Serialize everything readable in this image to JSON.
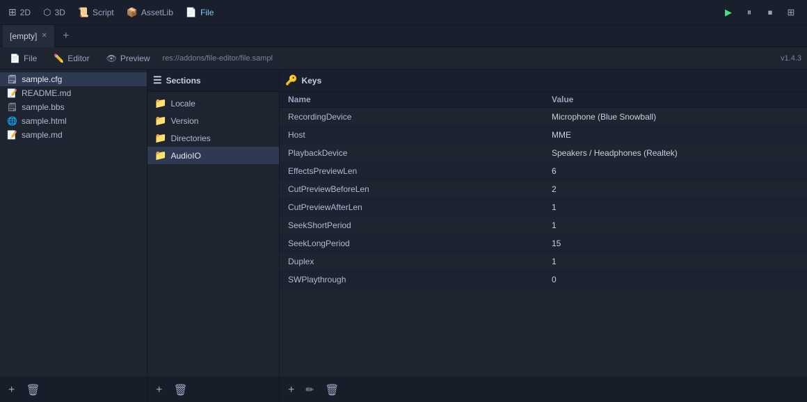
{
  "topbar": {
    "buttons": [
      {
        "id": "2d",
        "label": "2D",
        "icon": "2d-icon",
        "active": false
      },
      {
        "id": "3d",
        "label": "3D",
        "icon": "3d-icon",
        "active": false
      },
      {
        "id": "script",
        "label": "Script",
        "icon": "script-icon",
        "active": false
      },
      {
        "id": "assetlib",
        "label": "AssetLib",
        "icon": "assetlib-icon",
        "active": false
      },
      {
        "id": "file",
        "label": "File",
        "icon": "file-icon",
        "active": true
      }
    ],
    "controls": [
      "play",
      "pause",
      "stop",
      "layout"
    ]
  },
  "tabs": [
    {
      "id": "empty-tab",
      "label": "[empty]",
      "closable": true
    }
  ],
  "toolbar": {
    "file_btn": "File",
    "editor_btn": "Editor",
    "preview_btn": "Preview",
    "breadcrumb": "res://addons/file-editor/file.sampl",
    "version": "v1.4.3"
  },
  "sections_panel": {
    "header": "Sections",
    "items": [
      {
        "id": "locale",
        "label": "Locale",
        "icon": "folder-icon"
      },
      {
        "id": "version",
        "label": "Version",
        "icon": "folder-icon"
      },
      {
        "id": "directories",
        "label": "Directories",
        "icon": "folder-icon"
      },
      {
        "id": "audioio",
        "label": "AudioIO",
        "icon": "folder-icon",
        "active": true
      }
    ]
  },
  "keys_panel": {
    "header": "Keys",
    "col_name": "Name",
    "col_value": "Value",
    "rows": [
      {
        "name": "RecordingDevice",
        "value": "Microphone (Blue Snowball)"
      },
      {
        "name": "Host",
        "value": "MME"
      },
      {
        "name": "PlaybackDevice",
        "value": "Speakers / Headphones (Realtek)"
      },
      {
        "name": "EffectsPreviewLen",
        "value": "6"
      },
      {
        "name": "CutPreviewBeforeLen",
        "value": "2"
      },
      {
        "name": "CutPreviewAfterLen",
        "value": "1"
      },
      {
        "name": "SeekShortPeriod",
        "value": "1"
      },
      {
        "name": "SeekLongPeriod",
        "value": "15"
      },
      {
        "name": "Duplex",
        "value": "1"
      },
      {
        "name": "SWPlaythrough",
        "value": "0"
      }
    ]
  },
  "files_panel": {
    "items": [
      {
        "id": "sample-cfg",
        "label": "sample.cfg",
        "icon": "cfg-icon",
        "active": true
      },
      {
        "id": "readme-md",
        "label": "README.md",
        "icon": "md-icon",
        "active": false
      },
      {
        "id": "sample-bbs",
        "label": "sample.bbs",
        "icon": "bbs-icon",
        "active": false
      },
      {
        "id": "sample-html",
        "label": "sample.html",
        "icon": "html-icon",
        "active": false
      },
      {
        "id": "sample-md",
        "label": "sample.md",
        "icon": "md-icon",
        "active": false
      }
    ]
  },
  "icons": {
    "sections_header_icon": "☰",
    "keys_header_icon": "🔑",
    "folder": "📁",
    "add": "+",
    "trash": "🗑",
    "play": "▶",
    "pause": "⏸",
    "stop": "⏹",
    "layout": "⊞",
    "close": "✕"
  }
}
